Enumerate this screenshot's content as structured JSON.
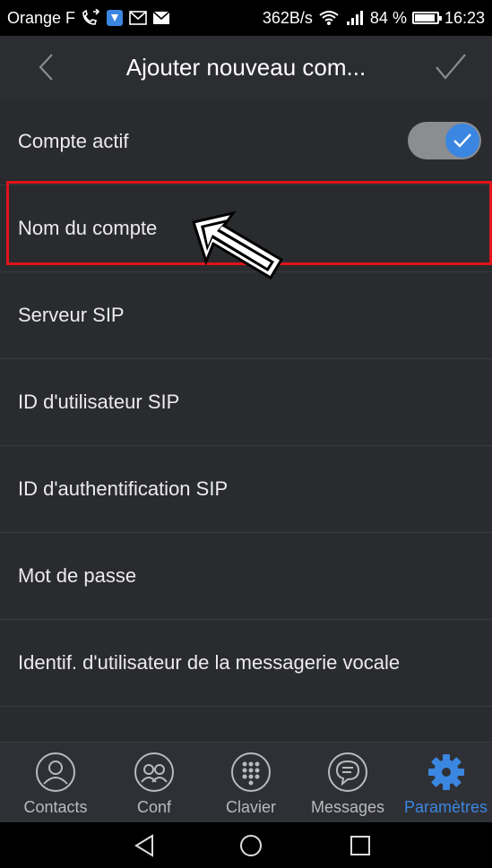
{
  "status_bar": {
    "carrier": "Orange F",
    "speed": "362B/s",
    "battery": "84 %",
    "battery_level": 0.84,
    "time": "16:23"
  },
  "header": {
    "title": "Ajouter nouveau com...",
    "back_icon": "chevron-left-icon",
    "confirm_icon": "checkmark-icon"
  },
  "settings": {
    "active_label": "Compte actif",
    "active_on": true,
    "rows": [
      "Nom du compte",
      "Serveur SIP",
      "ID d'utilisateur SIP",
      "ID d'authentification SIP",
      "Mot de passe",
      "Identif. d'utilisateur de la messagerie vocale"
    ]
  },
  "bottom_nav": [
    {
      "label": "Contacts",
      "icon": "person-icon"
    },
    {
      "label": "Conf",
      "icon": "group-icon"
    },
    {
      "label": "Clavier",
      "icon": "dialpad-icon"
    },
    {
      "label": "Messages",
      "icon": "chat-bubble-icon"
    },
    {
      "label": "Paramètres",
      "icon": "gear-icon",
      "active": true
    }
  ],
  "colors": {
    "accent": "#3a86e0",
    "highlight": "#e0141b",
    "background": "#2a2b2f"
  }
}
